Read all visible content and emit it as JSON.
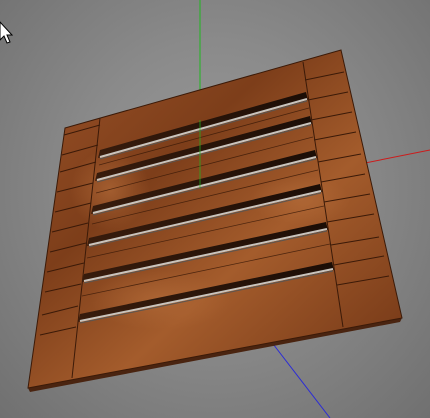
{
  "viewport": {
    "background_colors": [
      "#9a9a9a",
      "#8a8a8a",
      "#707070"
    ],
    "axis_colors": {
      "x": "#cc1b1b",
      "y": "#1fb81f",
      "z": "#2b2bd6"
    },
    "model": {
      "name": "rusted-vent-panel",
      "rust_colors": [
        "#8e4a22",
        "#7a3b18",
        "#a35a2a",
        "#6a3012"
      ],
      "slat_count": 6,
      "plank_count": 12
    },
    "cursor_icon": "arrow-cursor-icon"
  }
}
